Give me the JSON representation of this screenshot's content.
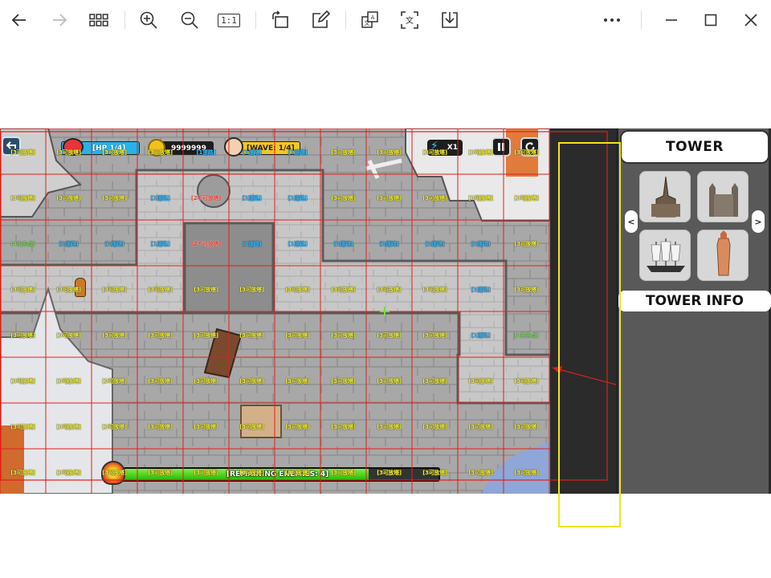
{
  "toolbar": {
    "buttons": [
      {
        "name": "back-button",
        "icon": "arrow-left-icon"
      },
      {
        "name": "forward-button",
        "icon": "arrow-right-icon",
        "disabled": true
      },
      {
        "name": "thumbnails-button",
        "icon": "grid-icon"
      },
      {
        "name": "zoom-in-button",
        "icon": "zoom-in-icon"
      },
      {
        "name": "zoom-out-button",
        "icon": "zoom-out-icon"
      },
      {
        "name": "actual-size-button",
        "icon": "actual-size-icon",
        "text": "1:1"
      },
      {
        "name": "rotate-button",
        "icon": "rotate-icon"
      },
      {
        "name": "edit-button",
        "icon": "edit-icon"
      },
      {
        "name": "translate-button",
        "icon": "translate-icon"
      },
      {
        "name": "ocr-button",
        "icon": "text-recognition-icon"
      },
      {
        "name": "download-button",
        "icon": "download-icon"
      },
      {
        "name": "more-button",
        "icon": "more-icon"
      },
      {
        "name": "minimize-button",
        "icon": "minimize-icon"
      },
      {
        "name": "maximize-button",
        "icon": "maximize-icon"
      },
      {
        "name": "close-button",
        "icon": "close-icon"
      }
    ],
    "actual_size_label": "1:1"
  },
  "game": {
    "hud": {
      "hp": "[HP 1/4]",
      "coins": "9999999",
      "wave": "[WAVE: 1/4]",
      "speed": "X1"
    },
    "progress": {
      "label": "[REMAINING ENEMIES: 4]",
      "fraction": 0.78
    },
    "grid": {
      "cols": 12,
      "rows": 8,
      "labels": {
        "available": "[3可放塔]",
        "road": "[1道路]",
        "blocked": "[2不可放塔]",
        "spawn": "[4出生点]"
      },
      "cells": [
        [
          "available",
          "available",
          "available",
          "available",
          "road",
          "road",
          "road",
          "available",
          "available",
          "available",
          "available",
          "available"
        ],
        [
          "available",
          "available",
          "available",
          "road",
          "blocked",
          "road",
          "road",
          "available",
          "available",
          "available",
          "available",
          "available"
        ],
        [
          "spawn",
          "road",
          "road",
          "road",
          "blocked",
          "road",
          "road",
          "road",
          "road",
          "road",
          "road",
          "available"
        ],
        [
          "available",
          "available",
          "available",
          "available",
          "available",
          "available",
          "available",
          "available",
          "available",
          "available",
          "road",
          "available"
        ],
        [
          "available",
          "available",
          "available",
          "available",
          "available",
          "available",
          "available",
          "available",
          "available",
          "available",
          "road",
          "spawn"
        ],
        [
          "available",
          "available",
          "available",
          "available",
          "available",
          "available",
          "available",
          "available",
          "available",
          "available",
          "available",
          "available"
        ],
        [
          "available",
          "available",
          "available",
          "available",
          "available",
          "available",
          "available",
          "available",
          "available",
          "available",
          "available",
          "available"
        ],
        [
          "available",
          "available",
          "available",
          "available",
          "available",
          "available",
          "available",
          "available",
          "available",
          "available",
          "available",
          "available"
        ]
      ]
    },
    "panel": {
      "title": "TOWER",
      "info_title": "TOWER INFO",
      "towers": [
        "gothic-spire-tower",
        "cathedral-tower",
        "sailing-ship-tower",
        "brick-tower"
      ],
      "prev_label": "<",
      "next_label": ">"
    }
  },
  "colors": {
    "grid_line": "#e0201a",
    "highlight_box": "#f3e21f",
    "panel_bg": "#595959",
    "hp_pill": "#26b3e8",
    "wave_pill": "#f3c623"
  }
}
